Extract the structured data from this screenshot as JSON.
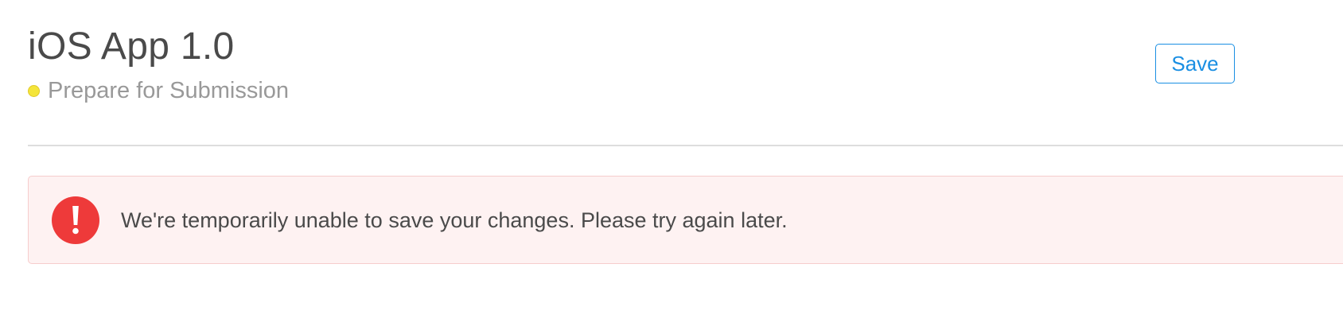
{
  "header": {
    "app_title": "iOS App 1.0",
    "status": {
      "label": "Prepare for Submission",
      "color": "#f4e53a"
    },
    "save_label": "Save"
  },
  "alert": {
    "type": "error",
    "icon": "exclamation-icon",
    "message": "We're temporarily unable to save your changes. Please try again later.",
    "color": "#ee3a3a"
  },
  "colors": {
    "accent": "#1a8fe3",
    "error_background": "#fef2f2",
    "error_border": "#f6cccc"
  }
}
